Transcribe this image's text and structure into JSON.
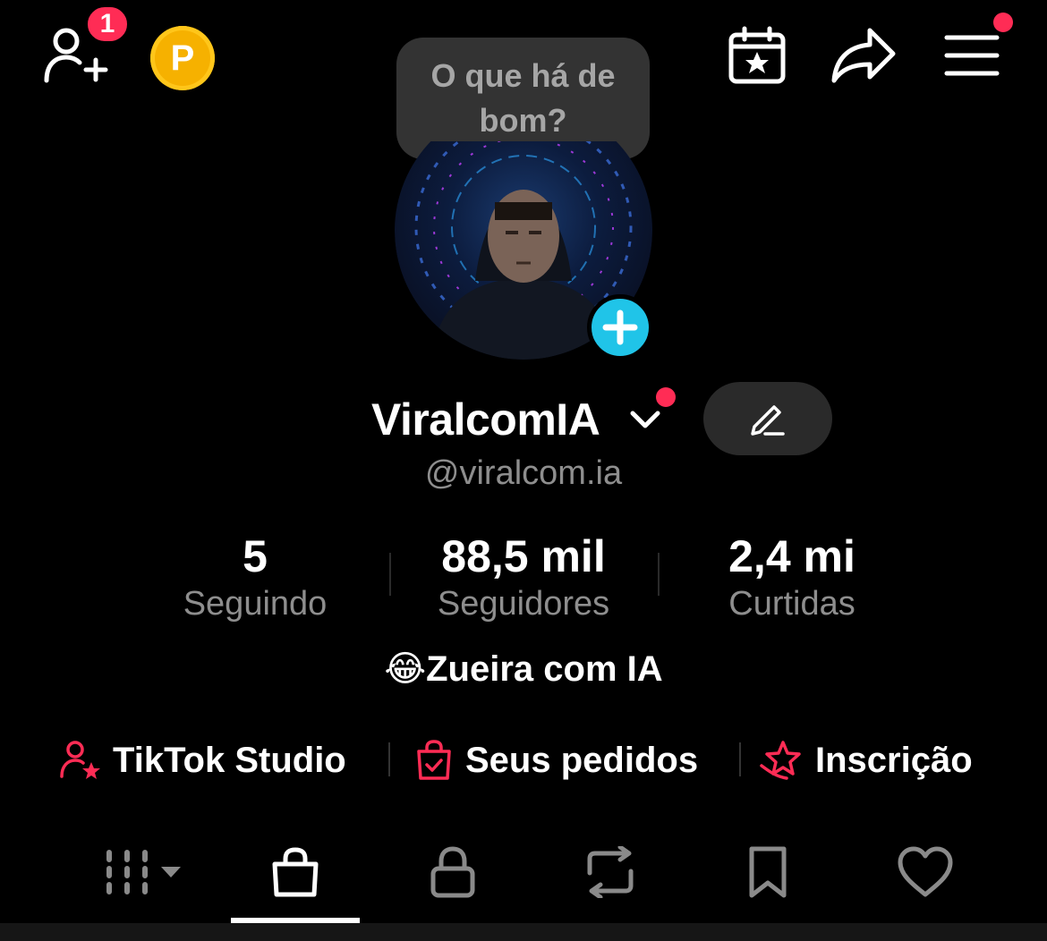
{
  "header": {
    "notification_count": "1",
    "coin_label": "P"
  },
  "tooltip": {
    "text": "O que há de bom?"
  },
  "profile": {
    "name": "ViralcomIA",
    "handle": "@viralcom.ia",
    "bio": "😂Zueira com IA"
  },
  "stats": [
    {
      "value": "5",
      "label": "Seguindo"
    },
    {
      "value": "88,5 mil",
      "label": "Seguidores"
    },
    {
      "value": "2,4 mi",
      "label": "Curtidas"
    }
  ],
  "shortcuts": [
    {
      "label": "TikTok Studio",
      "icon": "user-star-icon"
    },
    {
      "label": "Seus pedidos",
      "icon": "shopping-bag-check-icon"
    },
    {
      "label": "Inscrição",
      "icon": "star-hand-icon"
    }
  ],
  "tabs": [
    {
      "icon": "grid-icon",
      "active": false
    },
    {
      "icon": "shopping-bag-icon",
      "active": true
    },
    {
      "icon": "lock-icon",
      "active": false
    },
    {
      "icon": "repost-icon",
      "active": false
    },
    {
      "icon": "bookmark-icon",
      "active": false
    },
    {
      "icon": "heart-icon",
      "active": false
    }
  ],
  "colors": {
    "accent_red": "#ff2c55",
    "add_blue": "#20c4e8",
    "coin_gold": "#f6b100",
    "muted_text": "#8e8e8e"
  }
}
